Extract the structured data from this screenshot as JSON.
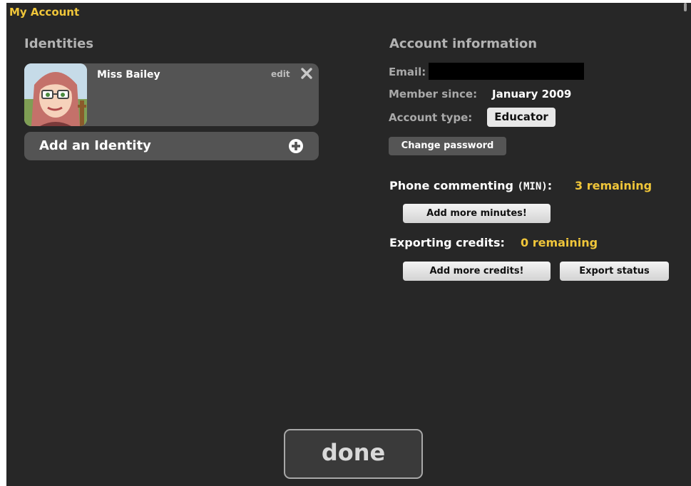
{
  "window": {
    "title": "My Account"
  },
  "identities": {
    "heading": "Identities",
    "items": [
      {
        "name": "Miss Bailey",
        "edit_label": "edit",
        "avatar_icon": "cartoon-avatar",
        "remove_icon": "close-icon"
      }
    ],
    "add_label": "Add an Identity",
    "add_icon": "plus-circle-icon"
  },
  "account": {
    "heading": "Account information",
    "email_label": "Email:",
    "member_since_label": "Member since:",
    "member_since_value": "January 2009",
    "account_type_label": "Account type:",
    "account_type_value": "Educator",
    "change_password_label": "Change password",
    "phone": {
      "label": "Phone commenting",
      "unit": "(MIN)",
      "colon": ":",
      "remaining": "3 remaining",
      "button": "Add more minutes!"
    },
    "export": {
      "label": "Exporting credits:",
      "remaining": "0 remaining",
      "button": "Add more credits!",
      "status_button": "Export status"
    }
  },
  "footer": {
    "done_label": "done"
  },
  "colors": {
    "accent": "#f0c63a",
    "background": "#272727",
    "card": "#545454"
  }
}
